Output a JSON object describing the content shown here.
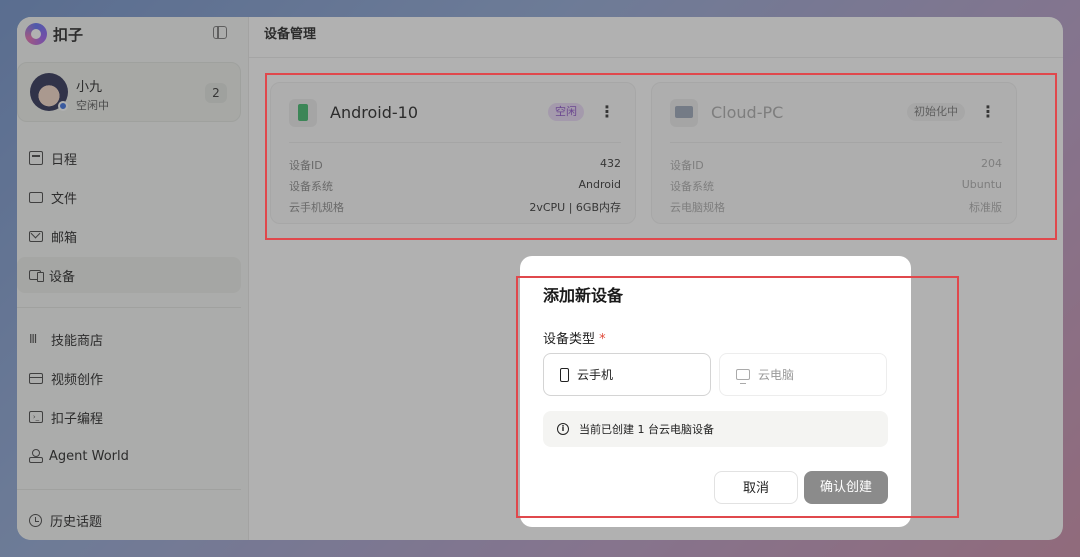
{
  "app": {
    "name": "扣子"
  },
  "user": {
    "name": "小九",
    "status": "空闲中",
    "badge": "2"
  },
  "sidebar": {
    "items": [
      {
        "label": "日程",
        "icon": "calendar-icon"
      },
      {
        "label": "文件",
        "icon": "folder-icon"
      },
      {
        "label": "邮箱",
        "icon": "mail-icon"
      },
      {
        "label": "设备",
        "icon": "device-icon",
        "active": true
      },
      {
        "label": "技能商店",
        "icon": "library-icon"
      },
      {
        "label": "视频创作",
        "icon": "clapper-icon"
      },
      {
        "label": "扣子编程",
        "icon": "code-icon"
      },
      {
        "label": "Agent World",
        "icon": "agent-icon"
      },
      {
        "label": "历史话题",
        "icon": "history-icon"
      }
    ]
  },
  "main": {
    "title": "设备管理"
  },
  "devices": [
    {
      "name": "Android-10",
      "tag": "空闲",
      "rows": [
        {
          "key": "设备ID",
          "value": "432"
        },
        {
          "key": "设备系统",
          "value": "Android"
        },
        {
          "key": "云手机规格",
          "value": "2vCPU | 6GB内存"
        }
      ]
    },
    {
      "name": "Cloud-PC",
      "tag": "初始化中",
      "rows": [
        {
          "key": "设备ID",
          "value": "204"
        },
        {
          "key": "设备系统",
          "value": "Ubuntu"
        },
        {
          "key": "云电脑规格",
          "value": "标准版"
        }
      ]
    }
  ],
  "modal": {
    "title": "添加新设备",
    "type_label": "设备类型",
    "required_mark": "*",
    "options": [
      {
        "label": "云手机",
        "state": "selected"
      },
      {
        "label": "云电脑",
        "state": "disabled"
      }
    ],
    "notice": "当前已创建 1 台云电脑设备",
    "cancel_label": "取消",
    "confirm_label": "确认创建"
  },
  "colors": {
    "highlight": "#e0484c",
    "idle_tag": "#8a4fc8",
    "confirm_button": "#8b8b8b"
  }
}
